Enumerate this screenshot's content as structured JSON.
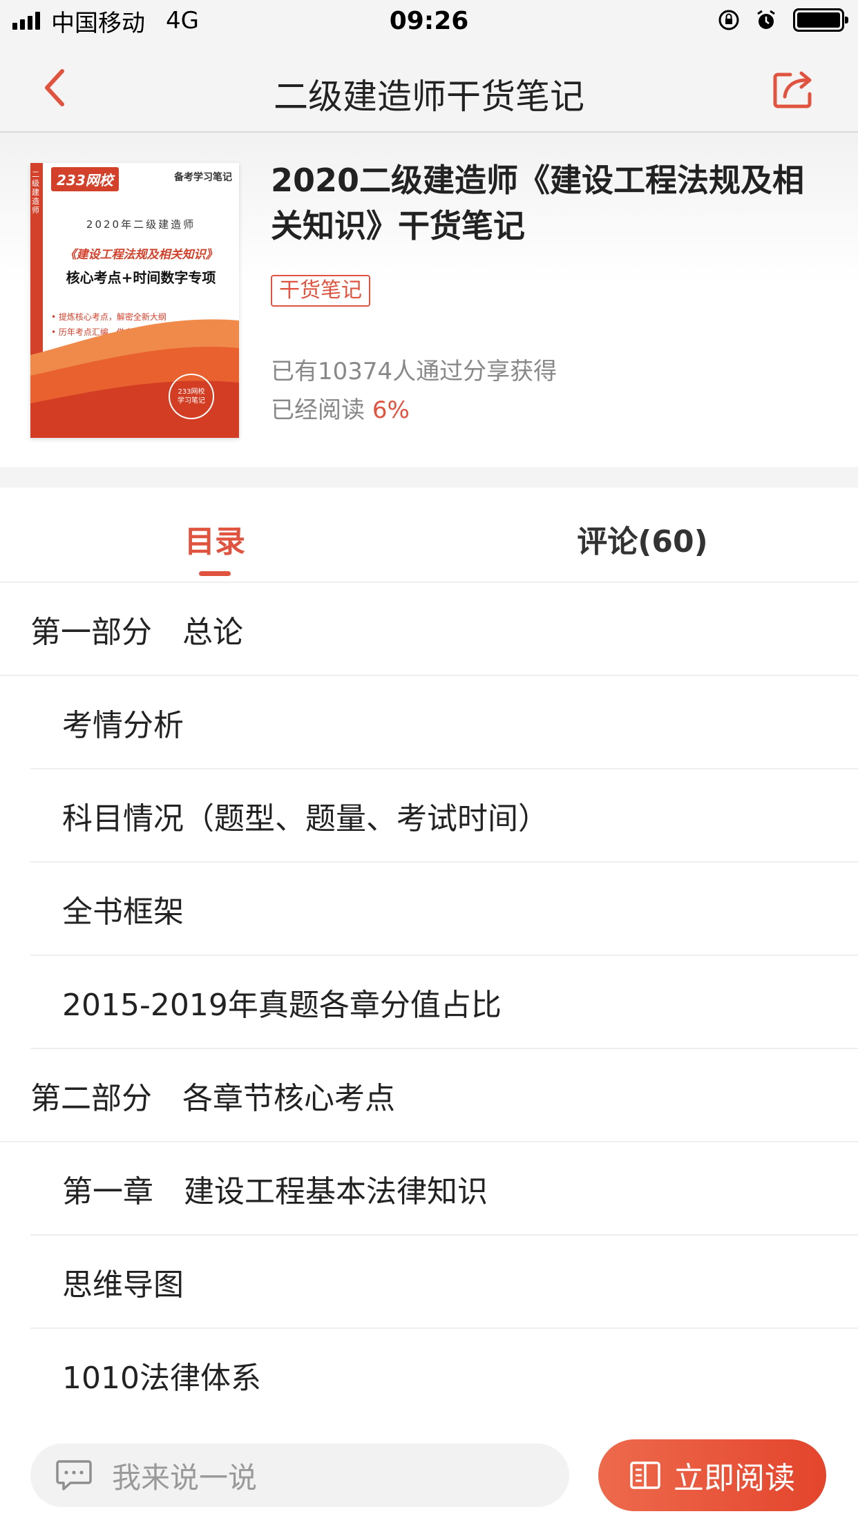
{
  "status_bar": {
    "carrier": "中国移动",
    "network": "4G",
    "time": "09:26"
  },
  "nav": {
    "title": "二级建造师干货笔记",
    "back_icon": "chevron-left-icon",
    "share_icon": "share-icon"
  },
  "book": {
    "title": "2020二级建造师《建设工程法规及相关知识》干货笔记",
    "badge": "干货笔记",
    "share_count_text": "已有10374人通过分享获得",
    "read_label": "已经阅读",
    "read_percent": "6%",
    "cover": {
      "logo": "233网校",
      "tag": "备考学习笔记",
      "side_text": "二级建造师",
      "year_line": "2020年二级建造师",
      "title_line1": "《建设工程法规及相关知识》",
      "title_line2": "核心考点+时间数字专项",
      "bullet1": "• 提炼核心考点，解密全新大纲",
      "bullet2": "• 历年考点汇编，做考试\"原题\"",
      "seal_line1": "233网校",
      "seal_line2": "学习笔记"
    }
  },
  "tabs": {
    "toc": "目录",
    "comments": "评论(60)"
  },
  "toc": [
    {
      "label": "第一部分　总论",
      "level": 1
    },
    {
      "label": "考情分析",
      "level": 2
    },
    {
      "label": "科目情况（题型、题量、考试时间）",
      "level": 2
    },
    {
      "label": "全书框架",
      "level": 2
    },
    {
      "label": "2015-2019年真题各章分值占比",
      "level": 2
    },
    {
      "label": "第二部分　各章节核心考点",
      "level": 1
    },
    {
      "label": "第一章　建设工程基本法律知识",
      "level": 2
    },
    {
      "label": "思维导图",
      "level": 2
    },
    {
      "label": "1010法律体系",
      "level": 2
    }
  ],
  "bottom_bar": {
    "comment_placeholder": "我来说一说",
    "read_button": "立即阅读"
  },
  "colors": {
    "accent": "#e0533f",
    "button_gradient_start": "#ee6a4d",
    "button_gradient_end": "#e3452c"
  }
}
